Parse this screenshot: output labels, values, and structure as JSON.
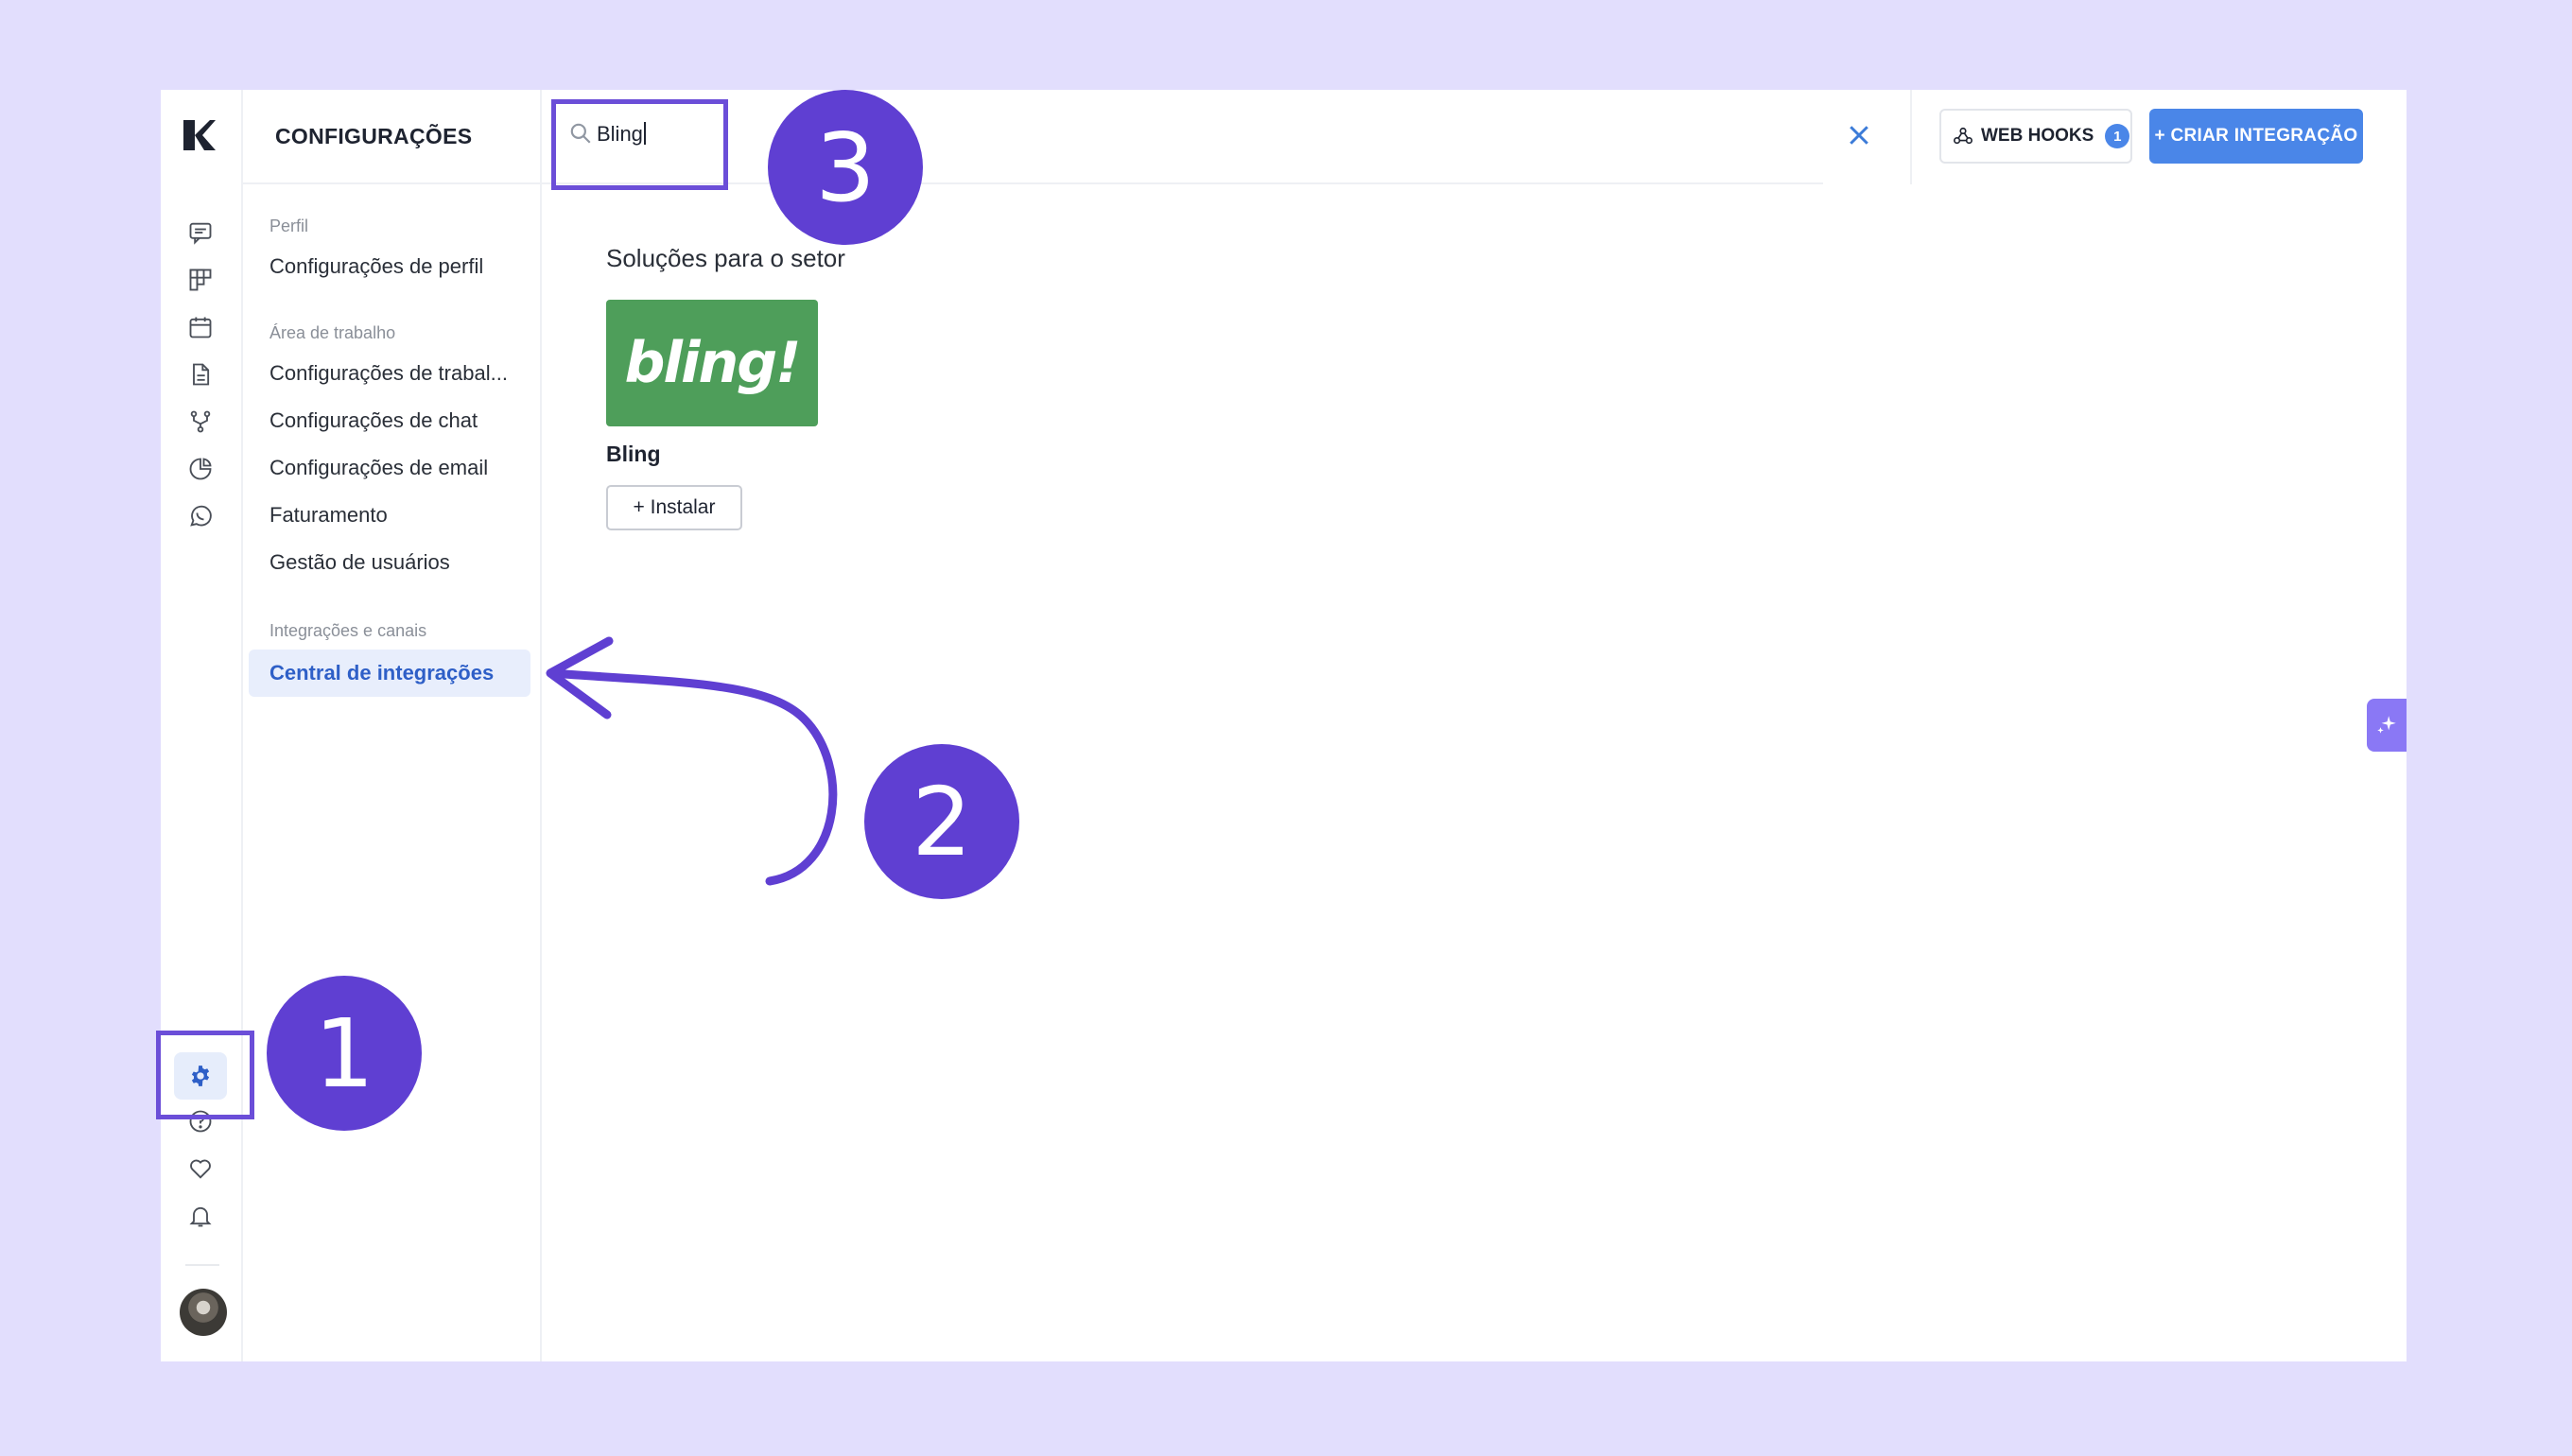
{
  "settings": {
    "title": "CONFIGURAÇÕES",
    "sections": [
      {
        "label": "Perfil",
        "items": [
          "Configurações de perfil"
        ]
      },
      {
        "label": "Área de trabalho",
        "items": [
          "Configurações de trabal...",
          "Configurações de chat",
          "Configurações de email",
          "Faturamento",
          "Gestão de usuários"
        ]
      },
      {
        "label": "Integrações e canais",
        "items": [
          "Central de integrações"
        ]
      }
    ],
    "active_item": "Central de integrações"
  },
  "rail": {
    "icons": [
      "logo-icon",
      "chat-icon",
      "kanban-icon",
      "calendar-icon",
      "document-icon",
      "flow-icon",
      "pie-chart-icon",
      "whatsapp-icon",
      "gear-icon",
      "help-icon",
      "heart-icon",
      "bell-icon",
      "avatar"
    ]
  },
  "search": {
    "value": "Bling"
  },
  "toolbar": {
    "webhooks_label": "WEB HOOKS",
    "webhooks_count": "1",
    "create_label": "+ CRIAR INTEGRAÇÃO"
  },
  "content": {
    "section_heading": "Soluções para o setor",
    "card": {
      "logo_text": "bling!",
      "name": "Bling",
      "install_label": "+ Instalar"
    }
  },
  "annotations": {
    "step1": "1",
    "step2": "2",
    "step3": "3"
  },
  "colors": {
    "accent": "#4a86e8",
    "annotation": "#5f3fd2",
    "active_text": "#2e5fc7",
    "bling_green": "#4e9e5a",
    "background": "#e2defd"
  }
}
